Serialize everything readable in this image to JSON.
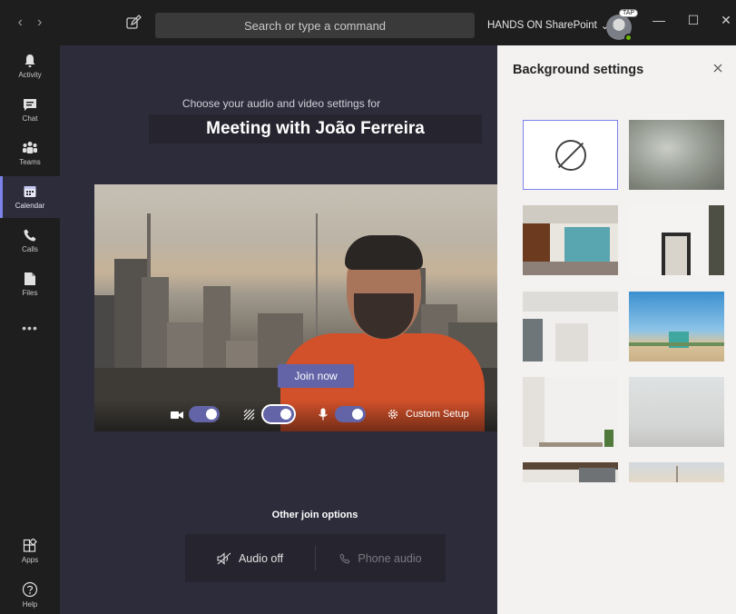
{
  "topbar": {
    "search_placeholder": "Search or type a command",
    "tenant_name": "HANDS ON SharePoint",
    "tenant_chevron": "⌄",
    "avatar_badge": "TAP",
    "presence_color": "#6bb700"
  },
  "rail": {
    "items": [
      {
        "label": "Activity",
        "icon": "bell-icon"
      },
      {
        "label": "Chat",
        "icon": "chat-icon"
      },
      {
        "label": "Teams",
        "icon": "teams-icon"
      },
      {
        "label": "Calendar",
        "icon": "calendar-icon",
        "active": true
      },
      {
        "label": "Calls",
        "icon": "phone-icon"
      },
      {
        "label": "Files",
        "icon": "file-icon"
      }
    ],
    "more": "•••",
    "apps_label": "Apps",
    "help_label": "Help"
  },
  "main": {
    "choose_text": "Choose your audio and video settings for",
    "meeting_title": "Meeting with João Ferreira",
    "join_button": "Join now",
    "custom_setup": "Custom Setup",
    "toggles": {
      "camera": true,
      "background_blur": true,
      "microphone": true
    },
    "other_join_options": "Other join options",
    "audio_off": "Audio off",
    "phone_audio": "Phone audio"
  },
  "panel": {
    "title": "Background settings",
    "thumbnails": [
      "none",
      "blur",
      "loft-office",
      "white-room",
      "white-hallway",
      "beach",
      "white-room-2",
      "grey-wall",
      "partial-1",
      "partial-2"
    ]
  },
  "colors": {
    "accent": "#6264a7",
    "rail_active": "#7b83eb",
    "app_bg": "#2d2c3b",
    "chrome": "#1e1e1e",
    "panel_bg": "#f3f2f1"
  }
}
